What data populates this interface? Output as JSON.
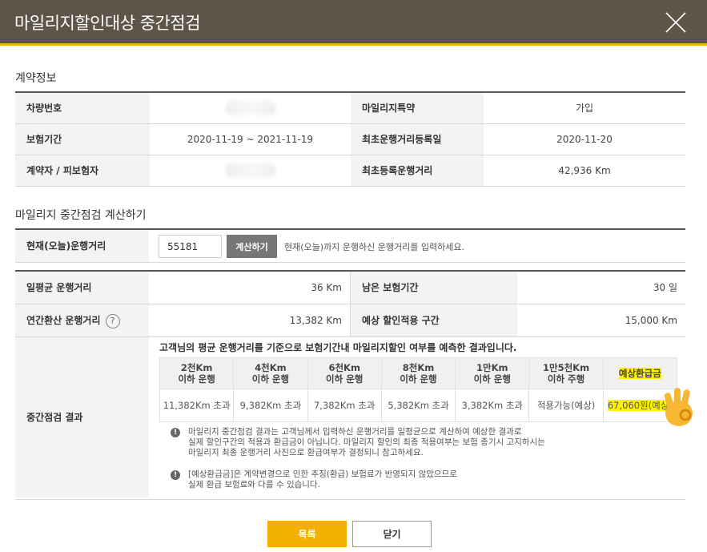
{
  "dialog": {
    "title": "마일리지할인대상 중간점검"
  },
  "contract": {
    "section_title": "계약정보",
    "rows": [
      {
        "l1": "차량번호",
        "v1": "",
        "l2": "마일리지특약",
        "v2": "가입"
      },
      {
        "l1": "보험기간",
        "v1": "2020-11-19 ~ 2021-11-19",
        "l2": "최초운행거리등록일",
        "v2": "2020-11-20"
      },
      {
        "l1": "계약자 / 피보험자",
        "v1": "",
        "l2": "최초등록운행거리",
        "v2": "42,936 Km"
      }
    ]
  },
  "calc": {
    "section_title": "마일리지 중간점검 계산하기",
    "label": "현재(오늘)운행거리",
    "input_value": "55181",
    "button_label": "계산하기",
    "hint": "현재(오늘)까지 운행하신 운행거리를 입력하세요."
  },
  "result": {
    "avg_label": "일평균 운행거리",
    "avg_value": "36 Km",
    "remain_label": "남은 보험기간",
    "remain_value": "30 일",
    "annual_label": "연간환산 운행거리",
    "annual_value": "13,382 Km",
    "discount_label": "예상 할인적용 구간",
    "discount_value": "15,000 Km",
    "help_icon": "?",
    "mid_label": "중간점검 결과",
    "description": "고객님의 평균 운행거리를 기준으로 보험기간내 마일리지할인 여부를 예측한 결과입니다.",
    "columns": [
      "2천Km\n이하 운행",
      "4천Km\n이하 운행",
      "6천Km\n이하 운행",
      "8천Km\n이하 운행",
      "1만Km\n이하 운행",
      "1만5천Km\n이하 주행",
      "예상환급금"
    ],
    "values": [
      "11,382Km 초과",
      "9,382Km 초과",
      "7,382Km 초과",
      "5,382Km 초과",
      "3,382Km 초과",
      "적용가능(예상)",
      "67,060원(예상)"
    ],
    "notice1": "마일리지 중간점검 결과는 고객님께서 입력하신 운행거리를 일평균으로 계산하여 예상한 결과로\n실제 할인구간의 적용과 환급금이 아닙니다. 마일리지 할인의 최종 적용여부는 보험 종기시 고지하시는\n마일리지 최종 운행거리 사진으로 환급여부가 결정되니 참고하세요.",
    "notice2": "[예상환급금]은 계약변경으로 인한 추징(환급) 보험료가 반영되지 않았으므로\n실제 환급 보험료와 다를 수 있습니다."
  },
  "buttons": {
    "list": "목록",
    "close": "닫기"
  },
  "colors": {
    "header": "#5e5548",
    "accent": "#f4b000",
    "highlight": "#fff200"
  }
}
